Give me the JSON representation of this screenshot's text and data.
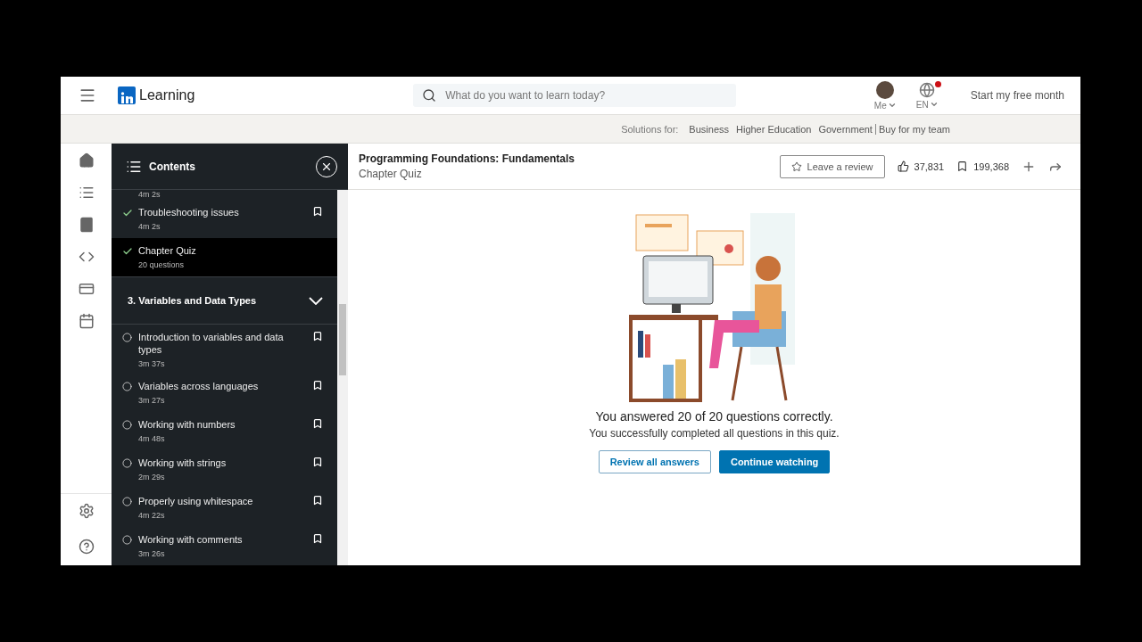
{
  "header": {
    "brand": "Learning",
    "search": {
      "placeholder": "What do you want to learn today?"
    },
    "me": "Me",
    "language": "EN",
    "language_notification": true,
    "cta": "Start my free month"
  },
  "solutions_bar": {
    "label": "Solutions for:",
    "links": [
      "Business",
      "Higher Education",
      "Government"
    ],
    "team_link": "Buy for my team"
  },
  "course": {
    "title": "Programming Foundations: Fundamentals",
    "subtitle": "Chapter Quiz",
    "review_button": "Leave a review",
    "likes": "37,831",
    "saves": "199,368"
  },
  "contents": {
    "title": "Contents",
    "top_fragment": "4m 2s",
    "items": [
      {
        "kind": "video",
        "title": "Troubleshooting issues",
        "meta": "4m 2s",
        "completed": true,
        "selected": false
      },
      {
        "kind": "quiz",
        "title": "Chapter Quiz",
        "meta": "20 questions",
        "completed": true,
        "selected": true
      },
      {
        "kind": "section",
        "title": "3. Variables and Data Types",
        "expanded": true,
        "children": [
          {
            "kind": "video",
            "title": "Introduction to variables and data types",
            "meta": "3m 37s",
            "completed": false,
            "selected": false
          },
          {
            "kind": "video",
            "title": "Variables across languages",
            "meta": "3m 27s",
            "completed": false,
            "selected": false
          },
          {
            "kind": "video",
            "title": "Working with numbers",
            "meta": "4m 48s",
            "completed": false,
            "selected": false
          },
          {
            "kind": "video",
            "title": "Working with strings",
            "meta": "2m 29s",
            "completed": false,
            "selected": false
          },
          {
            "kind": "video",
            "title": "Properly using whitespace",
            "meta": "4m 22s",
            "completed": false,
            "selected": false
          },
          {
            "kind": "video",
            "title": "Working with comments",
            "meta": "3m 26s",
            "completed": false,
            "selected": false
          }
        ]
      }
    ]
  },
  "quiz_result": {
    "headline": "You answered 20 of 20 questions correctly.",
    "message": "You successfully completed all questions in this quiz.",
    "buttons": [
      {
        "label": "Review all answers",
        "primary": false
      },
      {
        "label": "Continue watching",
        "primary": true
      }
    ]
  }
}
